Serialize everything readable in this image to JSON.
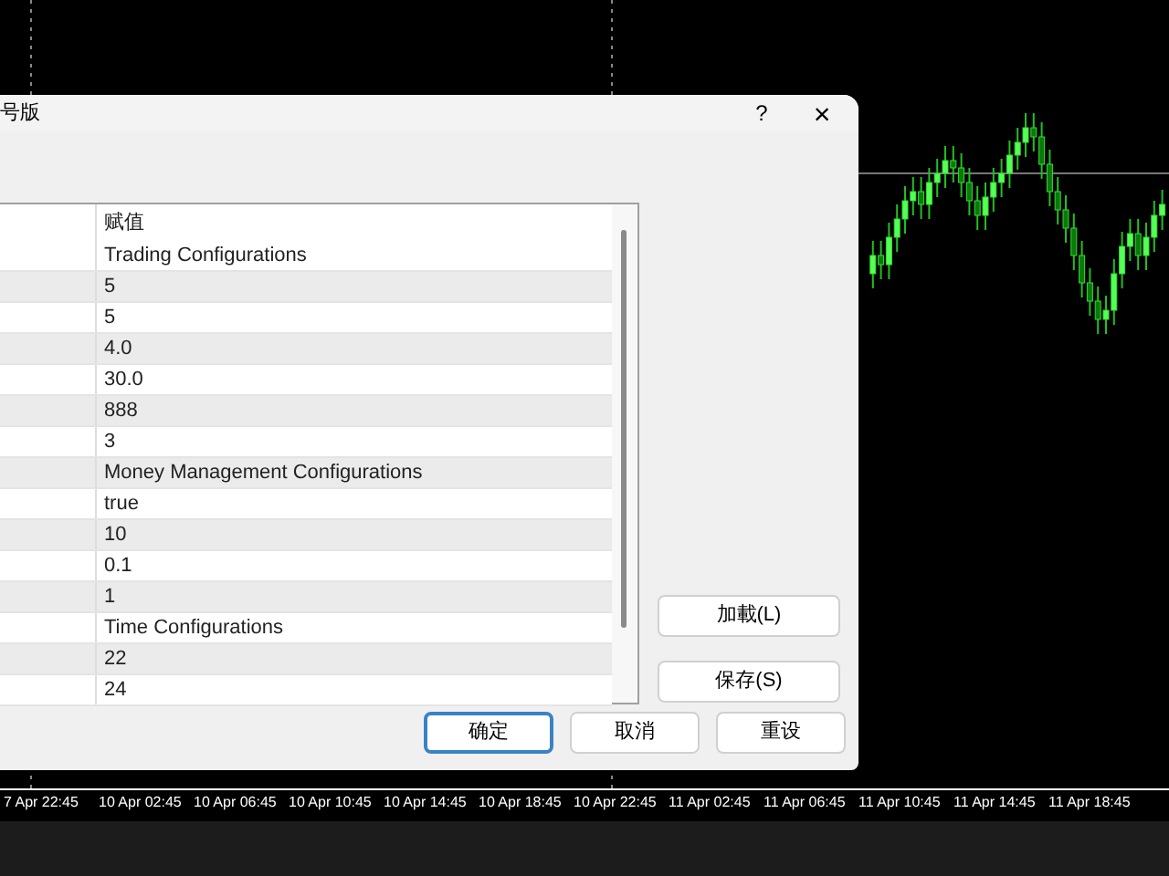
{
  "dialog": {
    "title": "号版",
    "help_button": "?",
    "close_button": "×"
  },
  "table": {
    "value_header": "赋值",
    "rows": [
      {
        "value": "Trading Configurations"
      },
      {
        "value": "5"
      },
      {
        "value": "5"
      },
      {
        "value": "4.0"
      },
      {
        "value": "30.0"
      },
      {
        "value": "888"
      },
      {
        "value": "3"
      },
      {
        "value": "Money Management Configurations"
      },
      {
        "value": "true"
      },
      {
        "value": "10"
      },
      {
        "value": "0.1"
      },
      {
        "value": "1"
      },
      {
        "value": "Time Configurations"
      },
      {
        "value": "22"
      },
      {
        "value": "24"
      }
    ]
  },
  "side_buttons": [
    {
      "label": "加載(L)"
    },
    {
      "label": "保存(S)"
    }
  ],
  "bottom_buttons": [
    {
      "label": "确定",
      "default": true
    },
    {
      "label": "取消",
      "default": false
    },
    {
      "label": "重设",
      "default": false
    }
  ],
  "time_axis": [
    "7 Apr 22:45",
    "10 Apr 02:45",
    "10 Apr 06:45",
    "10 Apr 10:45",
    "10 Apr 14:45",
    "10 Apr 18:45",
    "10 Apr 22:45",
    "11 Apr 02:45",
    "11 Apr 06:45",
    "11 Apr 10:45",
    "11 Apr 14:45",
    "11 Apr 18:45"
  ]
}
